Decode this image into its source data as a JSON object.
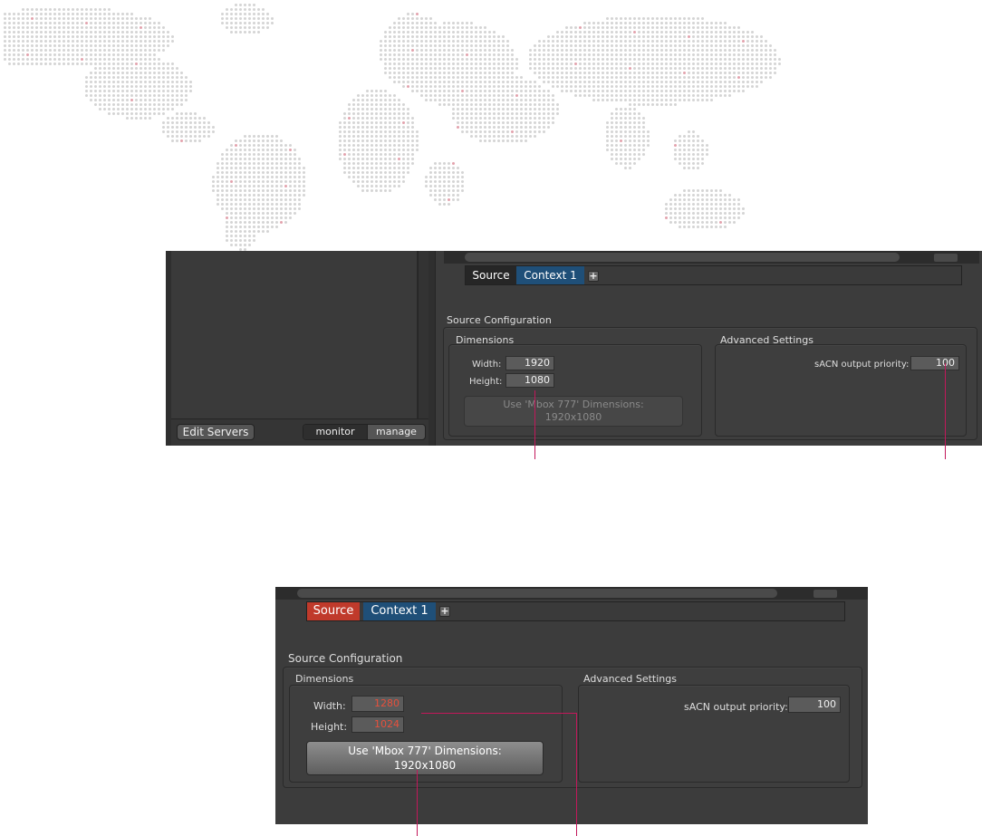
{
  "colors": {
    "accent_line": "#c2185b",
    "context_tab": "#1f4f78",
    "error_text": "#e8503c",
    "source_tab_selected": "#c03a2b"
  },
  "top": {
    "left_panel": {
      "edit_servers_label": "Edit Servers",
      "segment": [
        "monitor",
        "manage"
      ]
    },
    "tabs": {
      "source_label": "Source",
      "context_label": "Context 1",
      "add_icon": "plus-icon"
    },
    "source_configuration": {
      "title": "Source Configuration",
      "dimensions": {
        "title": "Dimensions",
        "width_label": "Width:",
        "width_value": "1920",
        "height_label": "Height:",
        "height_value": "1080",
        "button_line1": "Use 'Mbox 777' Dimensions:",
        "button_line2": "1920x1080"
      },
      "advanced": {
        "title": "Advanced Settings",
        "priority_label": "sACN output priority:",
        "priority_value": "100"
      }
    }
  },
  "bottom": {
    "tabs": {
      "source_label": "Source",
      "context_label": "Context 1",
      "add_icon": "plus-icon"
    },
    "source_configuration": {
      "title": "Source Configuration",
      "dimensions": {
        "title": "Dimensions",
        "width_label": "Width:",
        "width_value": "1280",
        "height_label": "Height:",
        "height_value": "1024",
        "button_line1": "Use 'Mbox 777' Dimensions:",
        "button_line2": "1920x1080"
      },
      "advanced": {
        "title": "Advanced Settings",
        "priority_label": "sACN output priority:",
        "priority_value": "100"
      }
    }
  }
}
